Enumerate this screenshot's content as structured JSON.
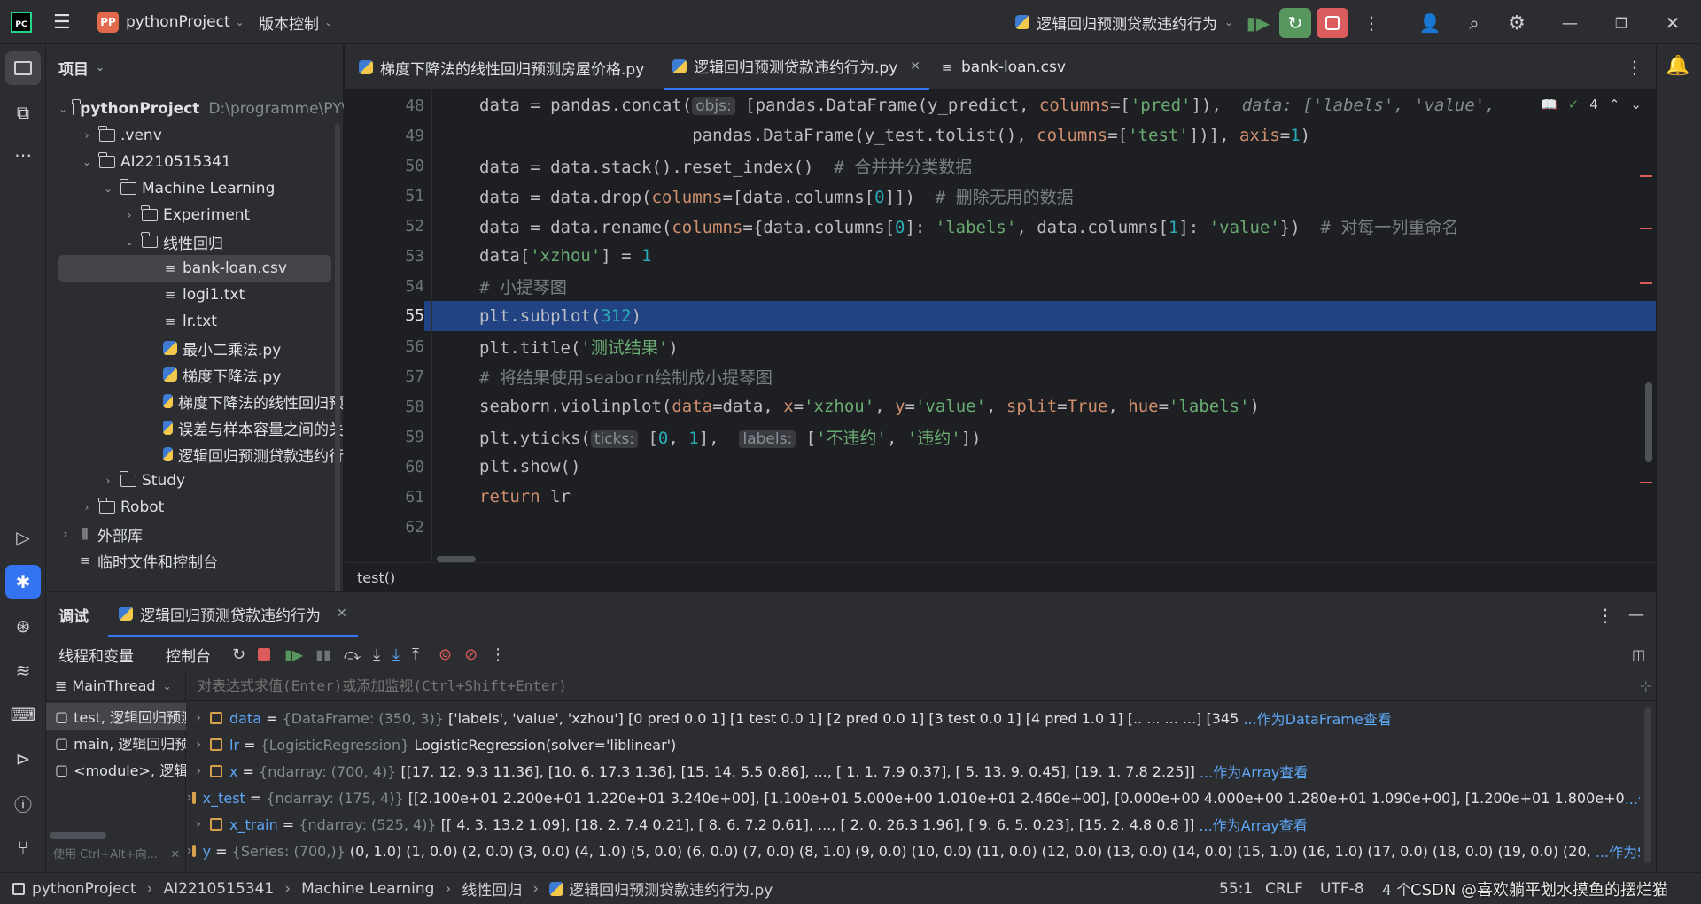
{
  "titlebar": {
    "project_badge": "PP",
    "project_name": "pythonProject",
    "vcs": "版本控制",
    "run_config": "逻辑回归预测贷款违约行为"
  },
  "project_panel": {
    "title": "项目",
    "items": [
      {
        "label": "pythonProject",
        "extra": "D:\\programme\\PY\\"
      },
      {
        "label": ".venv"
      },
      {
        "label": "AI2210515341"
      },
      {
        "label": "Machine Learning"
      },
      {
        "label": "Experiment"
      },
      {
        "label": "线性回归"
      },
      {
        "label": "bank-loan.csv"
      },
      {
        "label": "logi1.txt"
      },
      {
        "label": "lr.txt"
      },
      {
        "label": "最小二乘法.py"
      },
      {
        "label": "梯度下降法.py"
      },
      {
        "label": "梯度下降法的线性回归预"
      },
      {
        "label": "误差与样本容量之间的关"
      },
      {
        "label": "逻辑回归预测贷款违约行"
      },
      {
        "label": "Study"
      },
      {
        "label": "Robot"
      },
      {
        "label": "外部库"
      },
      {
        "label": "临时文件和控制台"
      }
    ]
  },
  "tabs": [
    {
      "label": "梯度下降法的线性回归预测房屋价格.py"
    },
    {
      "label": "逻辑回归预测贷款违约行为.py"
    },
    {
      "label": "bank-loan.csv"
    }
  ],
  "editor": {
    "warning_count": "4",
    "breadcrumb": "test()",
    "line_numbers": [
      "48",
      "49",
      "50",
      "51",
      "52",
      "53",
      "54",
      "55",
      "56",
      "57",
      "58",
      "59",
      "60",
      "61",
      "62"
    ],
    "current_line": "55"
  },
  "debug": {
    "title": "调试",
    "session_tab": "逻辑回归预测贷款违约行为",
    "subtab_threads": "线程和变量",
    "subtab_console": "控制台",
    "thread": "MainThread",
    "eval_placeholder": "对表达式求值(Enter)或添加监视(Ctrl+Shift+Enter)",
    "frames": [
      {
        "label": "test, 逻辑回归预测"
      },
      {
        "label": "main, 逻辑回归预"
      },
      {
        "label": "<module>, 逻辑回"
      }
    ],
    "frames_hint": "使用 Ctrl+Alt+向...",
    "variables": [
      {
        "name": "data",
        "type": "{DataFrame: (350, 3)}",
        "value": "['labels', 'value', 'xzhou'] [0     pred    0.0       1] [1     test    0.0       1] [2     pred    0.0       1] [3     test    0.0       1] [4     pred    1.0       1] [..   ...    ...     ...] [345",
        "link": "...作为DataFrame查看"
      },
      {
        "name": "lr",
        "type": "{LogisticRegression}",
        "value": "LogisticRegression(solver='liblinear')",
        "link": ""
      },
      {
        "name": "x",
        "type": "{ndarray: (700, 4)}",
        "value": "[[17.   12.    9.3  11.36], [10.    6.   17.3   1.36], [15.   14.    5.5   0.86], ..., [ 1.    1.    7.9   0.37], [ 5.   13.    9.    0.45], [19.    1.    7.8   2.25]]",
        "link": "...作为Array查看"
      },
      {
        "name": "x_test",
        "type": "{ndarray: (175, 4)}",
        "value": "[[2.100e+01 2.200e+01 1.220e+01 3.240e+00], [1.100e+01 5.000e+00 1.010e+01 2.460e+00], [0.000e+00 4.000e+00 1.280e+01 1.090e+00], [1.200e+01 1.800e+0",
        "link": "...作为Array查看"
      },
      {
        "name": "x_train",
        "type": "{ndarray: (525, 4)}",
        "value": "[[ 4.    3.   13.2   1.09], [18.    2.    7.4   0.21], [ 8.    6.    7.2   0.61], ..., [ 2.    0.   26.3   1.96], [ 9.    6.    5.    0.23], [15.    2.    4.8   0.8 ]]",
        "link": "...作为Array查看"
      },
      {
        "name": "y",
        "type": "{Series: (700,)}",
        "value": "(0, 1.0) (1, 0.0) (2, 0.0) (3, 0.0) (4, 1.0) (5, 0.0) (6, 0.0) (7, 0.0) (8, 1.0) (9, 0.0) (10, 0.0) (11, 0.0) (12, 0.0) (13, 0.0) (14, 0.0) (15, 1.0) (16, 1.0) (17, 0.0) (18, 0.0) (19, 0.0) (20,",
        "link": "...作为Series查看"
      }
    ]
  },
  "statusbar": {
    "crumbs": [
      "pythonProject",
      "AI2210515341",
      "Machine Learning",
      "线性回归",
      "逻辑回归预测贷款违约行为.py"
    ],
    "position": "55:1",
    "line_sep": "CRLF",
    "encoding": "UTF-8",
    "indent": "4 个",
    "watermark": "CSDN @喜欢躺平划水摸鱼的摆烂猫"
  },
  "colors": {
    "accent": "#3574f0",
    "selection": "#214283",
    "debug_green": "#57965c",
    "stop_red": "#db5c5c"
  }
}
